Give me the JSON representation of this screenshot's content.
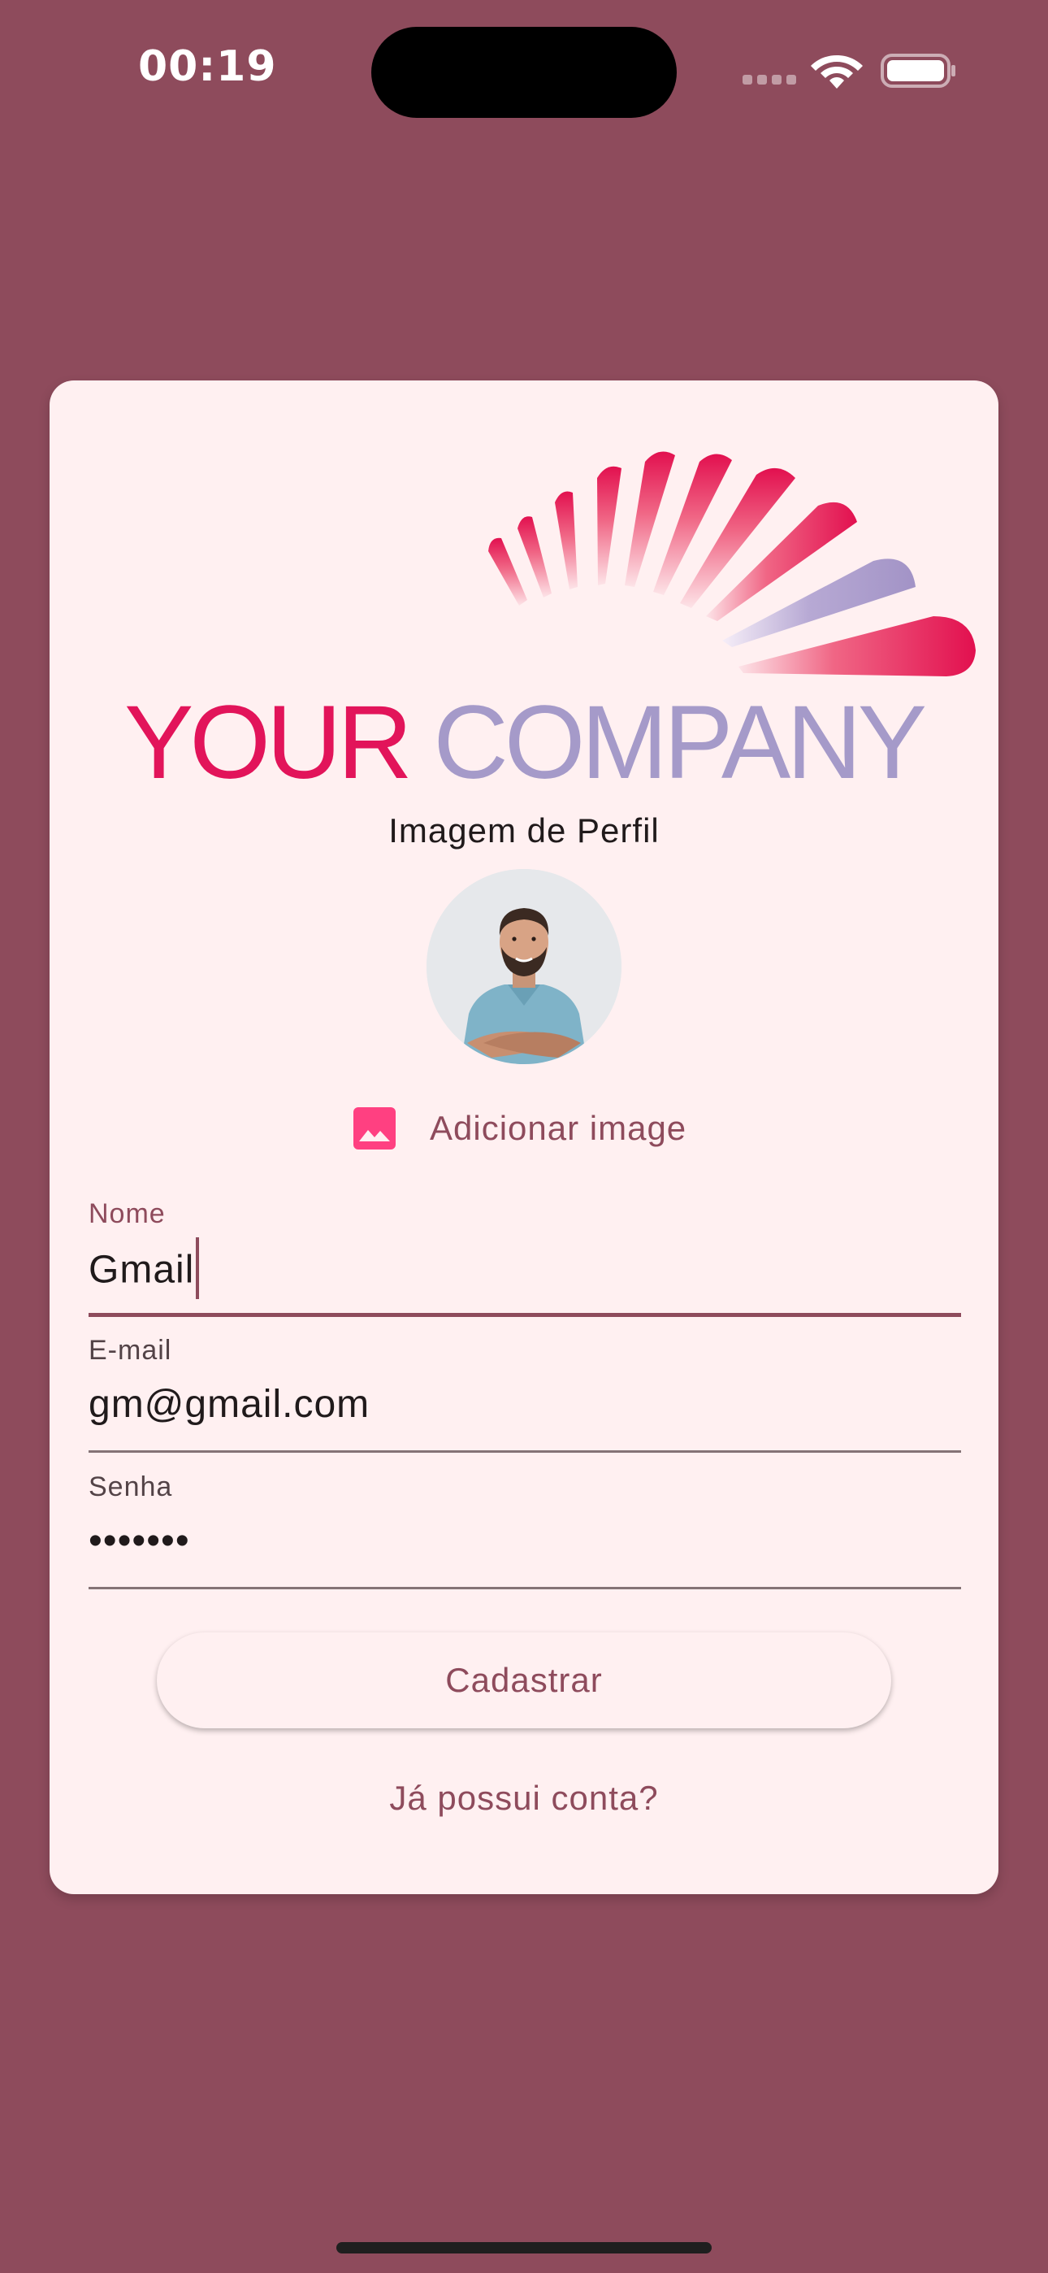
{
  "status_bar": {
    "time": "00:19",
    "wifi_icon": "wifi-icon",
    "battery_icon": "battery-icon"
  },
  "logo": {
    "word1": "YOUR",
    "word2": "COMPANY",
    "colors": {
      "primary": "#e2145a",
      "secondary": "#a59ac9"
    }
  },
  "profile": {
    "title": "Imagem de Perfil",
    "add_image_label": "Adicionar image",
    "add_image_icon": "image-icon"
  },
  "form": {
    "name": {
      "label": "Nome",
      "value": "Gmail"
    },
    "email": {
      "label": "E-mail",
      "value": "gm@gmail.com"
    },
    "password": {
      "label": "Senha",
      "value": "•••••••"
    }
  },
  "actions": {
    "register_label": "Cadastrar",
    "login_link_label": "Já possui conta?"
  },
  "theme": {
    "background": "#8e4b5c",
    "card": "#fff0f1",
    "accent": "#8e4b5c",
    "icon_pink": "#ff4081"
  }
}
